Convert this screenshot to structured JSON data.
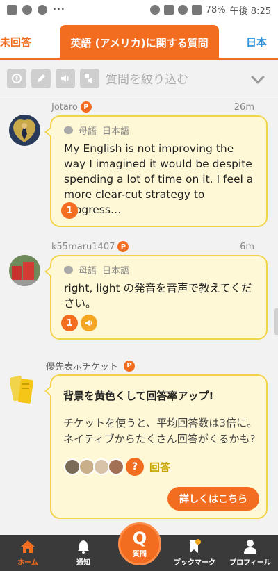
{
  "statusbar": {
    "battery": "78%",
    "time": "午後 8:25",
    "dots": "···"
  },
  "tabs": {
    "left": "未回答",
    "active": "英語 (アメリカ)に関する質問",
    "right": "日本"
  },
  "filter": {
    "label": "質問を絞り込む",
    "icons": [
      "note-icon",
      "pencil-icon",
      "speaker-icon",
      "translate-speaker-icon"
    ]
  },
  "questions": [
    {
      "username": "Jotaro",
      "badge": "P",
      "time": "26m",
      "native_label": "母語",
      "native_lang": "日本語",
      "text": "My English is not improving the way I imagined it would be despite spending a lot of time on it. I feel a more clear-cut strategy to progress…",
      "answer_count": "1"
    },
    {
      "username": "k55maru1407",
      "badge": "P",
      "time": "6m",
      "native_label": "母語",
      "native_lang": "日本語",
      "text": "right, light の発音を音声で教えてください。",
      "answer_count": "1"
    }
  ],
  "ticket": {
    "label": "優先表示チケット",
    "badge": "P",
    "title": "背景を黄色くして回答率アップ!",
    "body": "チケットを使うと、平均回答数は3倍に。ネイティブからたくさん回答がくるかも?",
    "answer_word": "回答",
    "question_mark": "?",
    "cta": "詳しくはこちら"
  },
  "bottomnav": {
    "home": "ホーム",
    "notify": "通知",
    "ask_letter": "Q",
    "ask": "質問",
    "bookmark": "ブックマーク",
    "profile": "プロフィール"
  },
  "colors": {
    "accent": "#f26d1f",
    "card_bg": "#fff8d6",
    "card_border": "#f2d44a",
    "link_blue": "#2a8fd8"
  }
}
